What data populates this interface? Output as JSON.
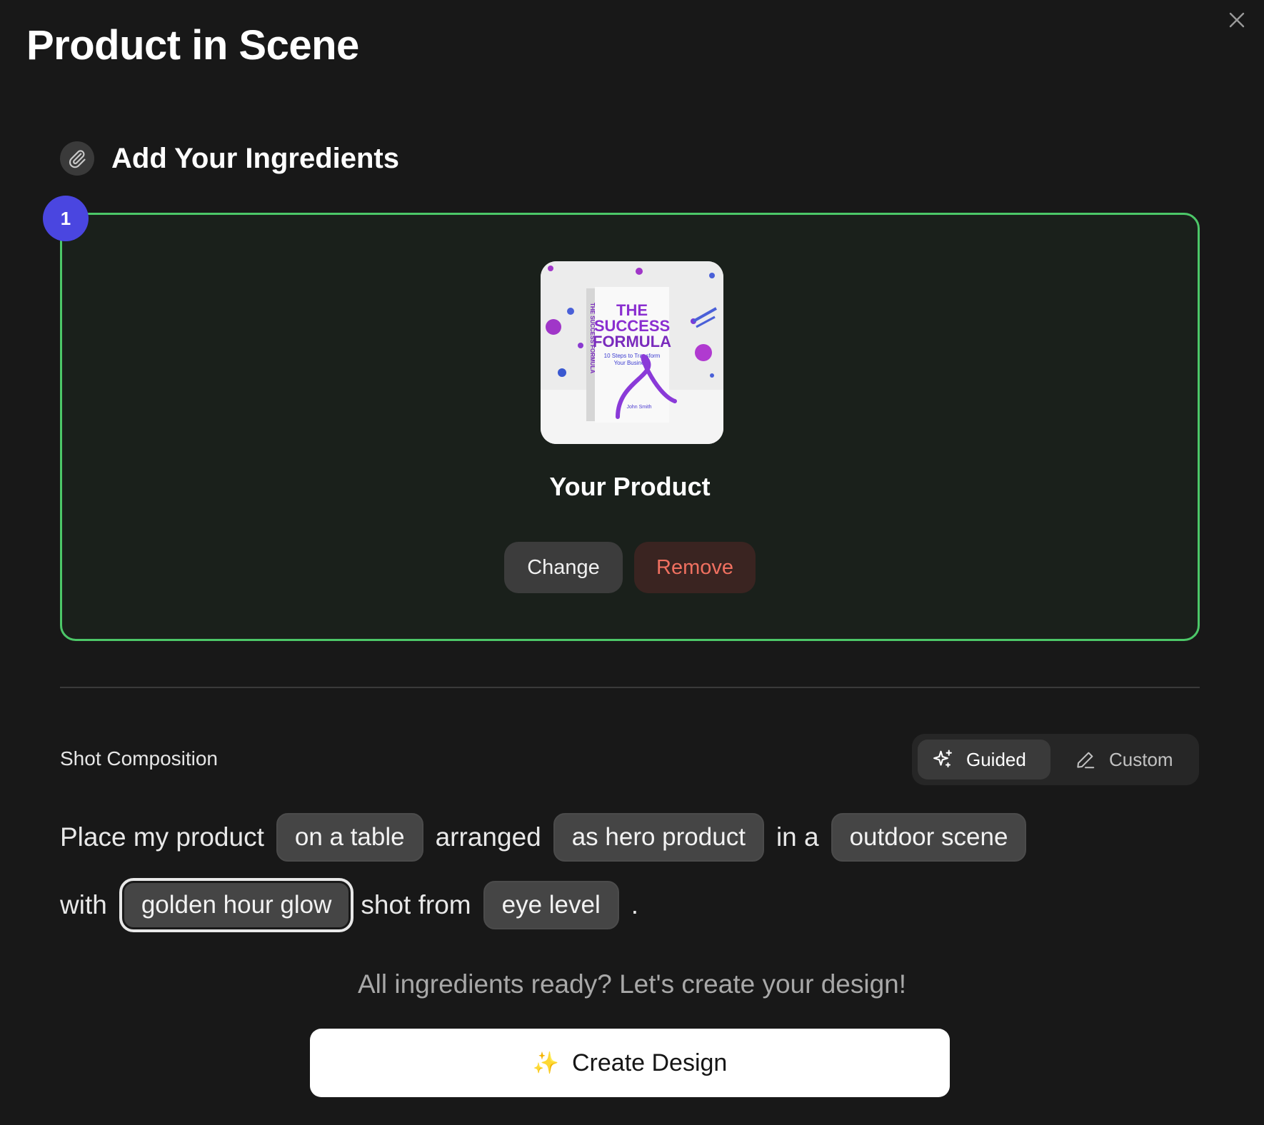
{
  "modal": {
    "title": "Product in Scene"
  },
  "ingredients": {
    "section_title": "Add Your Ingredients",
    "step_number": "1",
    "product": {
      "label": "Your Product",
      "thumbnail": {
        "title_line1": "THE",
        "title_line2": "SUCCESS",
        "title_line3": "FORMULA",
        "subtitle_line1": "10 Steps to Transform",
        "subtitle_line2": "Your Business",
        "author": "John Smith",
        "spine_text": "THE SUCCESS FORMULA"
      }
    },
    "change_label": "Change",
    "remove_label": "Remove"
  },
  "composition": {
    "label": "Shot Composition",
    "modes": [
      {
        "label": "Guided",
        "icon": "sparkles-icon",
        "active": true
      },
      {
        "label": "Custom",
        "icon": "pencil-icon",
        "active": false
      }
    ],
    "sentence": {
      "w1": "Place my product",
      "chip_surface": "on a table",
      "w2": "arranged",
      "chip_arrangement": "as hero product",
      "w3": "in a",
      "chip_scene": "outdoor scene",
      "w4": "with",
      "chip_lighting": "golden hour glow",
      "w5": "shot from",
      "chip_angle": "eye level",
      "end": "."
    }
  },
  "footer": {
    "ready_text": "All ingredients ready? Let's create your design!",
    "create_icon": "✨",
    "create_label": "Create Design"
  },
  "colors": {
    "background": "#181818",
    "accent_green": "#4cc768",
    "step_badge": "#4a46e0",
    "remove_text": "#f07060"
  }
}
